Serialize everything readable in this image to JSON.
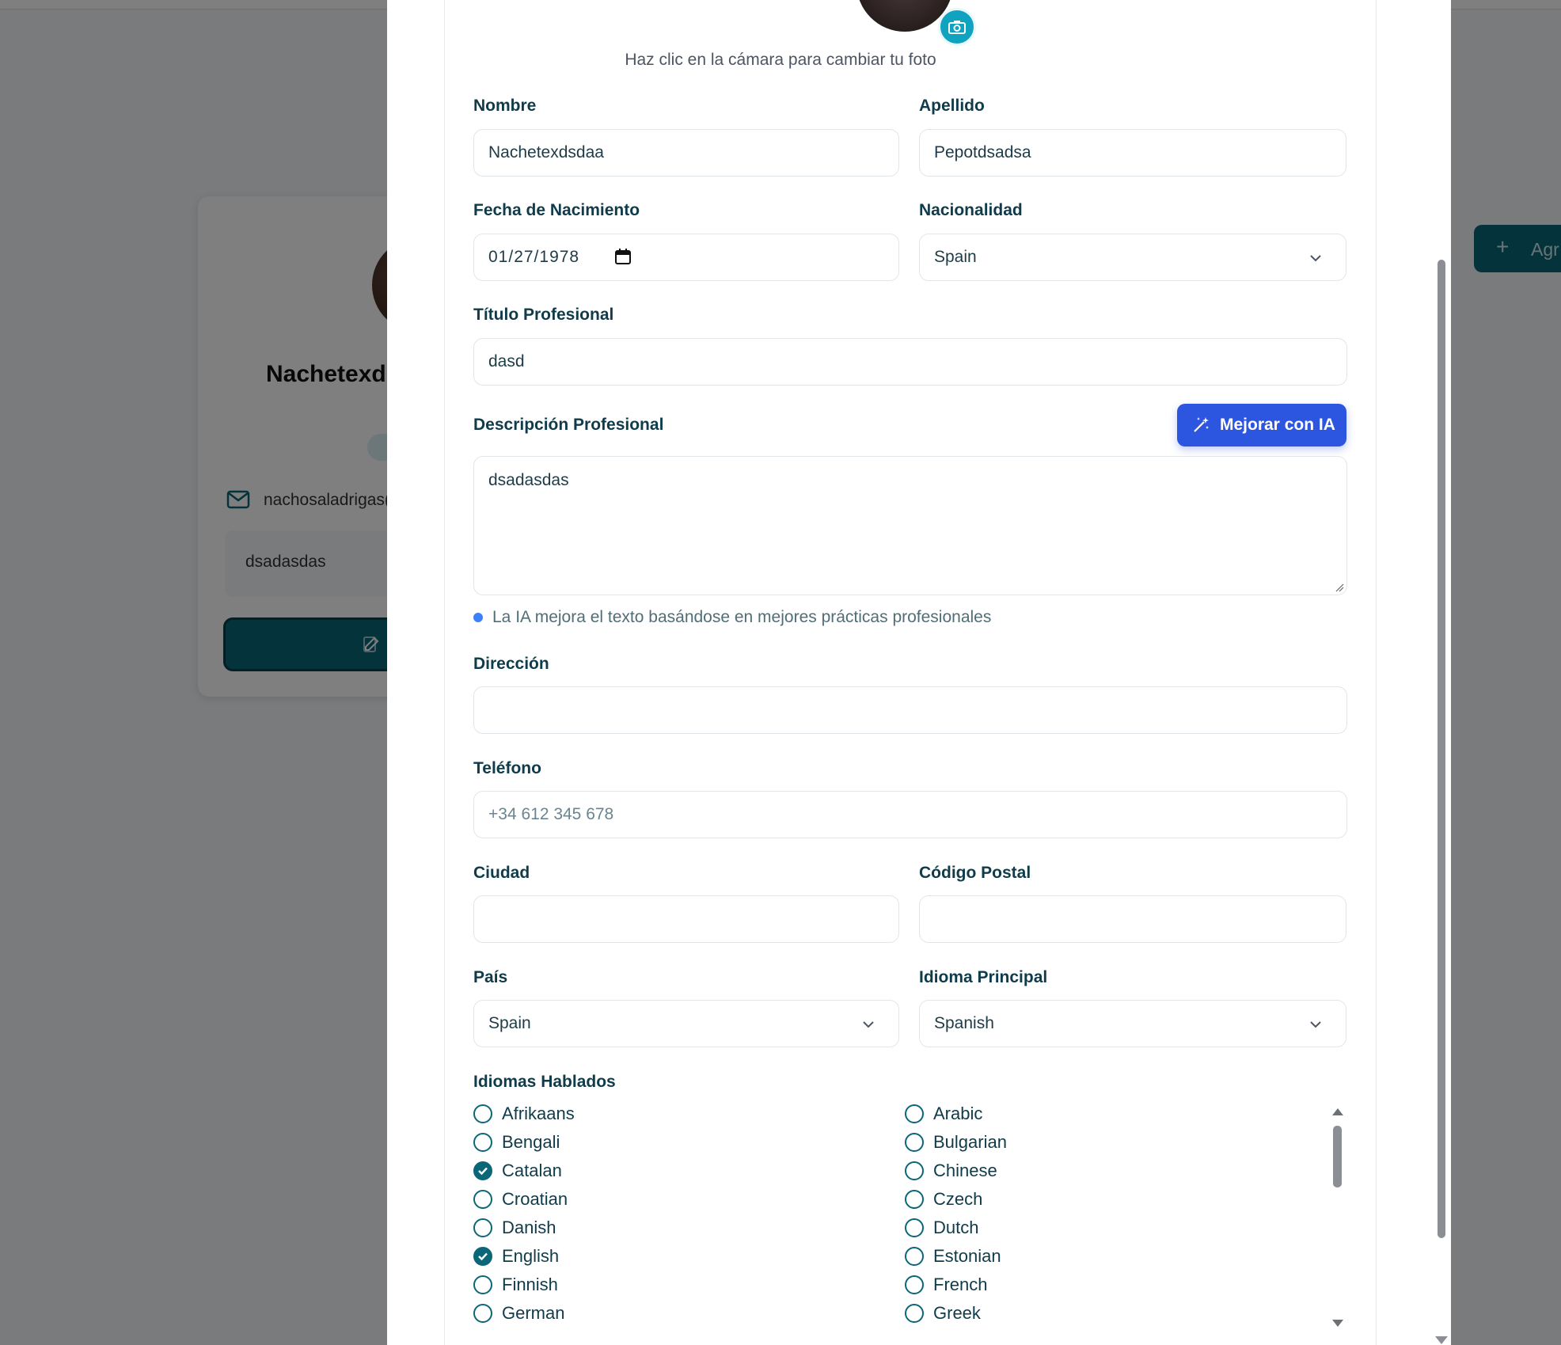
{
  "background": {
    "profile_name": "Nachetexd",
    "email": "nachosaladrigas(",
    "description": "dsadasdas",
    "add_button_label": "Agr"
  },
  "modal": {
    "photo_hint": "Haz clic en la cámara para cambiar tu foto",
    "nombre": {
      "label": "Nombre",
      "value": "Nachetexdsdaa"
    },
    "apellido": {
      "label": "Apellido",
      "value": "Pepotdsadsa"
    },
    "fecha": {
      "label": "Fecha de Nacimiento",
      "value": "01/27/1978"
    },
    "nacionalidad": {
      "label": "Nacionalidad",
      "value": "Spain"
    },
    "titulo": {
      "label": "Título Profesional",
      "value": "dasd"
    },
    "descripcion": {
      "label": "Descripción Profesional",
      "value": "dsadasdas",
      "ai_button": "Mejorar con IA",
      "ai_note": "La IA mejora el texto basándose en mejores prácticas profesionales"
    },
    "direccion": {
      "label": "Dirección",
      "value": ""
    },
    "telefono": {
      "label": "Teléfono",
      "placeholder": "+34 612 345 678"
    },
    "ciudad": {
      "label": "Ciudad",
      "value": ""
    },
    "codigo_postal": {
      "label": "Código Postal",
      "value": ""
    },
    "pais": {
      "label": "País",
      "value": "Spain"
    },
    "idioma_principal": {
      "label": "Idioma Principal",
      "value": "Spanish"
    },
    "idiomas": {
      "label": "Idiomas Hablados",
      "left": [
        {
          "name": "Afrikaans",
          "checked": false
        },
        {
          "name": "Bengali",
          "checked": false
        },
        {
          "name": "Catalan",
          "checked": true
        },
        {
          "name": "Croatian",
          "checked": false
        },
        {
          "name": "Danish",
          "checked": false
        },
        {
          "name": "English",
          "checked": true
        },
        {
          "name": "Finnish",
          "checked": false
        },
        {
          "name": "German",
          "checked": false
        }
      ],
      "right": [
        {
          "name": "Arabic",
          "checked": false
        },
        {
          "name": "Bulgarian",
          "checked": false
        },
        {
          "name": "Chinese",
          "checked": false
        },
        {
          "name": "Czech",
          "checked": false
        },
        {
          "name": "Dutch",
          "checked": false
        },
        {
          "name": "Estonian",
          "checked": false
        },
        {
          "name": "French",
          "checked": false
        },
        {
          "name": "Greek",
          "checked": false
        }
      ]
    }
  },
  "colors": {
    "accent": "#0b6778",
    "ai_button": "#2d56e0",
    "camera": "#0fa3bf"
  }
}
